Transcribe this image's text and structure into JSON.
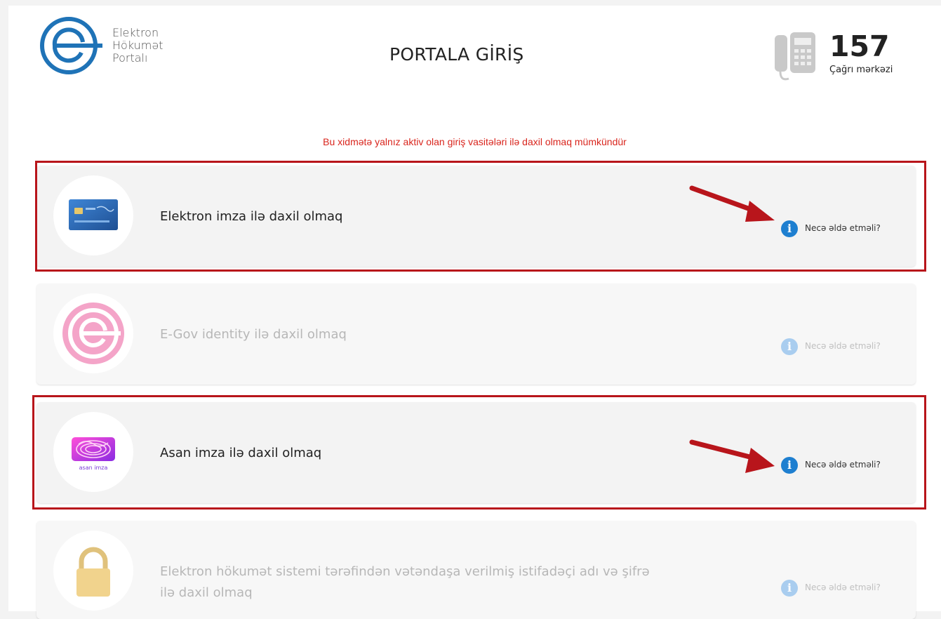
{
  "header": {
    "logo_lines": [
      "Elektron",
      "Hökumət",
      "Portalı"
    ],
    "title": "PORTALA GİRİŞ",
    "call_center_number": "157",
    "call_center_label": "Çağrı mərkəzi"
  },
  "notice": "Bu xidmətə yalnız aktiv olan giriş vasitələri ilə daxil olmaq mümkündür",
  "options": [
    {
      "label": "Elektron imza ilə daxil olmaq",
      "info": "Necə əldə etməli?",
      "active": true,
      "highlighted": true
    },
    {
      "label": "E-Gov identity ilə daxil olmaq",
      "info": "Necə əldə etməli?",
      "active": false,
      "highlighted": false
    },
    {
      "label": "Asan imza ilə daxil olmaq",
      "info": "Necə əldə etməli?",
      "active": true,
      "highlighted": true
    },
    {
      "label_line1": "Elektron hökumət sistemi tərəfindən vətəndaşa verilmiş istifadəçi adı və şifrə",
      "label_line2": "ilə daxil olmaq",
      "info": "Necə əldə etməli?",
      "active": false,
      "highlighted": false
    }
  ],
  "asan_card_text": "asan imza",
  "colors": {
    "accent_blue": "#1e7fd0",
    "notice_red": "#d9251d",
    "highlight_red": "#b8151b"
  },
  "icons": [
    "egov-logo-icon",
    "phone-icon",
    "smart-card-icon",
    "egov-identity-icon",
    "asan-imza-icon",
    "lock-icon",
    "info-icon",
    "arrow-annotation-icon"
  ]
}
